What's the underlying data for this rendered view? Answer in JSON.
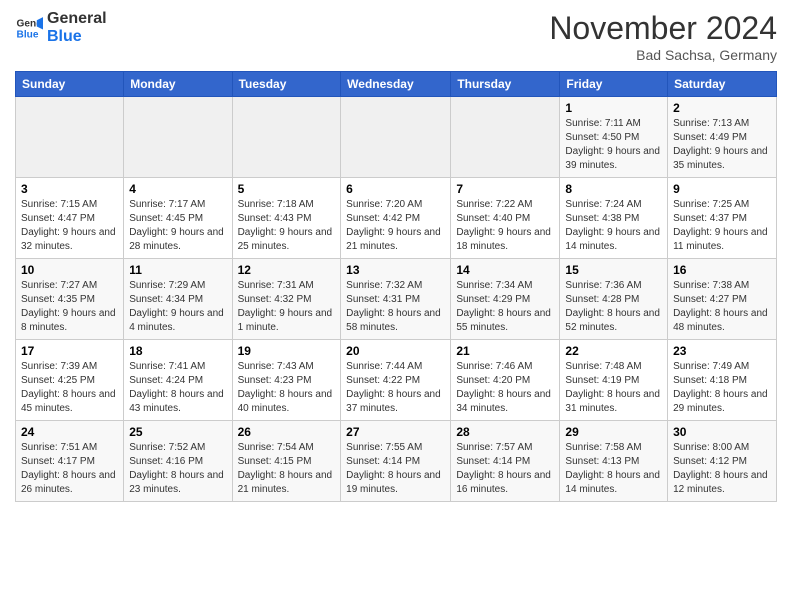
{
  "header": {
    "logo_line1": "General",
    "logo_line2": "Blue",
    "month": "November 2024",
    "location": "Bad Sachsa, Germany"
  },
  "weekdays": [
    "Sunday",
    "Monday",
    "Tuesday",
    "Wednesday",
    "Thursday",
    "Friday",
    "Saturday"
  ],
  "rows": [
    [
      {
        "day": "",
        "info": ""
      },
      {
        "day": "",
        "info": ""
      },
      {
        "day": "",
        "info": ""
      },
      {
        "day": "",
        "info": ""
      },
      {
        "day": "",
        "info": ""
      },
      {
        "day": "1",
        "info": "Sunrise: 7:11 AM\nSunset: 4:50 PM\nDaylight: 9 hours and 39 minutes."
      },
      {
        "day": "2",
        "info": "Sunrise: 7:13 AM\nSunset: 4:49 PM\nDaylight: 9 hours and 35 minutes."
      }
    ],
    [
      {
        "day": "3",
        "info": "Sunrise: 7:15 AM\nSunset: 4:47 PM\nDaylight: 9 hours and 32 minutes."
      },
      {
        "day": "4",
        "info": "Sunrise: 7:17 AM\nSunset: 4:45 PM\nDaylight: 9 hours and 28 minutes."
      },
      {
        "day": "5",
        "info": "Sunrise: 7:18 AM\nSunset: 4:43 PM\nDaylight: 9 hours and 25 minutes."
      },
      {
        "day": "6",
        "info": "Sunrise: 7:20 AM\nSunset: 4:42 PM\nDaylight: 9 hours and 21 minutes."
      },
      {
        "day": "7",
        "info": "Sunrise: 7:22 AM\nSunset: 4:40 PM\nDaylight: 9 hours and 18 minutes."
      },
      {
        "day": "8",
        "info": "Sunrise: 7:24 AM\nSunset: 4:38 PM\nDaylight: 9 hours and 14 minutes."
      },
      {
        "day": "9",
        "info": "Sunrise: 7:25 AM\nSunset: 4:37 PM\nDaylight: 9 hours and 11 minutes."
      }
    ],
    [
      {
        "day": "10",
        "info": "Sunrise: 7:27 AM\nSunset: 4:35 PM\nDaylight: 9 hours and 8 minutes."
      },
      {
        "day": "11",
        "info": "Sunrise: 7:29 AM\nSunset: 4:34 PM\nDaylight: 9 hours and 4 minutes."
      },
      {
        "day": "12",
        "info": "Sunrise: 7:31 AM\nSunset: 4:32 PM\nDaylight: 9 hours and 1 minute."
      },
      {
        "day": "13",
        "info": "Sunrise: 7:32 AM\nSunset: 4:31 PM\nDaylight: 8 hours and 58 minutes."
      },
      {
        "day": "14",
        "info": "Sunrise: 7:34 AM\nSunset: 4:29 PM\nDaylight: 8 hours and 55 minutes."
      },
      {
        "day": "15",
        "info": "Sunrise: 7:36 AM\nSunset: 4:28 PM\nDaylight: 8 hours and 52 minutes."
      },
      {
        "day": "16",
        "info": "Sunrise: 7:38 AM\nSunset: 4:27 PM\nDaylight: 8 hours and 48 minutes."
      }
    ],
    [
      {
        "day": "17",
        "info": "Sunrise: 7:39 AM\nSunset: 4:25 PM\nDaylight: 8 hours and 45 minutes."
      },
      {
        "day": "18",
        "info": "Sunrise: 7:41 AM\nSunset: 4:24 PM\nDaylight: 8 hours and 43 minutes."
      },
      {
        "day": "19",
        "info": "Sunrise: 7:43 AM\nSunset: 4:23 PM\nDaylight: 8 hours and 40 minutes."
      },
      {
        "day": "20",
        "info": "Sunrise: 7:44 AM\nSunset: 4:22 PM\nDaylight: 8 hours and 37 minutes."
      },
      {
        "day": "21",
        "info": "Sunrise: 7:46 AM\nSunset: 4:20 PM\nDaylight: 8 hours and 34 minutes."
      },
      {
        "day": "22",
        "info": "Sunrise: 7:48 AM\nSunset: 4:19 PM\nDaylight: 8 hours and 31 minutes."
      },
      {
        "day": "23",
        "info": "Sunrise: 7:49 AM\nSunset: 4:18 PM\nDaylight: 8 hours and 29 minutes."
      }
    ],
    [
      {
        "day": "24",
        "info": "Sunrise: 7:51 AM\nSunset: 4:17 PM\nDaylight: 8 hours and 26 minutes."
      },
      {
        "day": "25",
        "info": "Sunrise: 7:52 AM\nSunset: 4:16 PM\nDaylight: 8 hours and 23 minutes."
      },
      {
        "day": "26",
        "info": "Sunrise: 7:54 AM\nSunset: 4:15 PM\nDaylight: 8 hours and 21 minutes."
      },
      {
        "day": "27",
        "info": "Sunrise: 7:55 AM\nSunset: 4:14 PM\nDaylight: 8 hours and 19 minutes."
      },
      {
        "day": "28",
        "info": "Sunrise: 7:57 AM\nSunset: 4:14 PM\nDaylight: 8 hours and 16 minutes."
      },
      {
        "day": "29",
        "info": "Sunrise: 7:58 AM\nSunset: 4:13 PM\nDaylight: 8 hours and 14 minutes."
      },
      {
        "day": "30",
        "info": "Sunrise: 8:00 AM\nSunset: 4:12 PM\nDaylight: 8 hours and 12 minutes."
      }
    ]
  ]
}
